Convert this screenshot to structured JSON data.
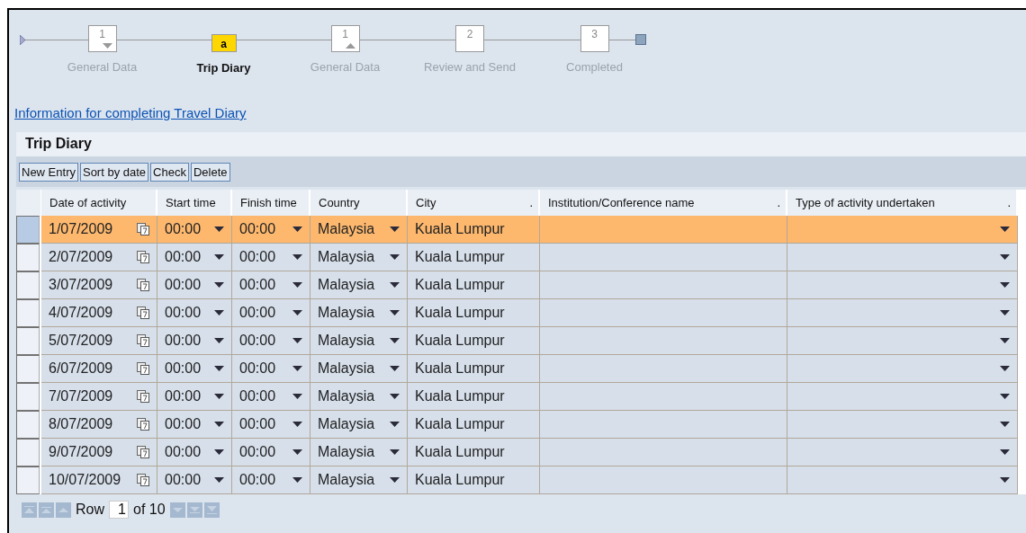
{
  "steps": [
    {
      "number": "1",
      "label": "General Data",
      "selected": false,
      "kind": "down"
    },
    {
      "number": "a",
      "label": "Trip Diary",
      "selected": true,
      "kind": "sub"
    },
    {
      "number": "1",
      "label": "General Data",
      "selected": false,
      "kind": "up"
    },
    {
      "number": "2",
      "label": "Review and Send",
      "selected": false,
      "kind": "plain"
    },
    {
      "number": "3",
      "label": "Completed",
      "selected": false,
      "kind": "plain"
    }
  ],
  "info_link": "Information for completing Travel Diary",
  "panel": {
    "title": "Trip Diary",
    "buttons": [
      "New Entry",
      "Sort by date",
      "Check",
      "Delete"
    ]
  },
  "table": {
    "columns": [
      {
        "label": "Date of activity"
      },
      {
        "label": "Start time"
      },
      {
        "label": "Finish time"
      },
      {
        "label": "Country"
      },
      {
        "label": "City",
        "mark": "."
      },
      {
        "label": "Institution/Conference name",
        "mark": "."
      },
      {
        "label": "Type of activity undertaken",
        "mark": "."
      }
    ],
    "rows": [
      {
        "selected": true,
        "date": "1/07/2009",
        "start_time": "00:00",
        "finish_time": "00:00",
        "country": "Malaysia",
        "city": "Kuala Lumpur"
      },
      {
        "selected": false,
        "date": "2/07/2009",
        "start_time": "00:00",
        "finish_time": "00:00",
        "country": "Malaysia",
        "city": "Kuala Lumpur"
      },
      {
        "selected": false,
        "date": "3/07/2009",
        "start_time": "00:00",
        "finish_time": "00:00",
        "country": "Malaysia",
        "city": "Kuala Lumpur"
      },
      {
        "selected": false,
        "date": "4/07/2009",
        "start_time": "00:00",
        "finish_time": "00:00",
        "country": "Malaysia",
        "city": "Kuala Lumpur"
      },
      {
        "selected": false,
        "date": "5/07/2009",
        "start_time": "00:00",
        "finish_time": "00:00",
        "country": "Malaysia",
        "city": "Kuala Lumpur"
      },
      {
        "selected": false,
        "date": "6/07/2009",
        "start_time": "00:00",
        "finish_time": "00:00",
        "country": "Malaysia",
        "city": "Kuala Lumpur"
      },
      {
        "selected": false,
        "date": "7/07/2009",
        "start_time": "00:00",
        "finish_time": "00:00",
        "country": "Malaysia",
        "city": "Kuala Lumpur"
      },
      {
        "selected": false,
        "date": "8/07/2009",
        "start_time": "00:00",
        "finish_time": "00:00",
        "country": "Malaysia",
        "city": "Kuala Lumpur"
      },
      {
        "selected": false,
        "date": "9/07/2009",
        "start_time": "00:00",
        "finish_time": "00:00",
        "country": "Malaysia",
        "city": "Kuala Lumpur"
      },
      {
        "selected": false,
        "date": "10/07/2009",
        "start_time": "00:00",
        "finish_time": "00:00",
        "country": "Malaysia",
        "city": "Kuala Lumpur"
      }
    ]
  },
  "pager": {
    "label": "Row",
    "value": "1",
    "total": "of 10"
  }
}
